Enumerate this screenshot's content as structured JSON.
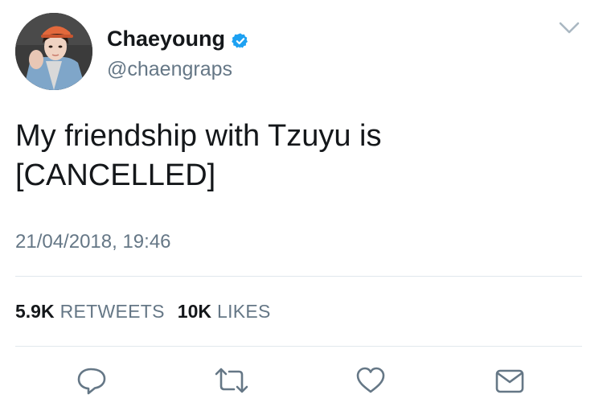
{
  "tweet": {
    "author": {
      "display_name": "Chaeyoung",
      "handle": "@chaengraps",
      "verified": true
    },
    "text_lines": [
      "My friendship with Tzuyu is",
      "[CANCELLED]"
    ],
    "timestamp": "21/04/2018, 19:46",
    "stats": {
      "retweets_count": "5.9K",
      "retweets_label": "RETWEETS",
      "likes_count": "10K",
      "likes_label": "LIKES"
    },
    "actions": [
      "reply-icon",
      "retweet-icon",
      "like-icon",
      "share-icon"
    ]
  },
  "colors": {
    "text": "#14171a",
    "secondary": "#657786",
    "verified_blue": "#1da1f2",
    "divider": "#e1e8ed"
  }
}
